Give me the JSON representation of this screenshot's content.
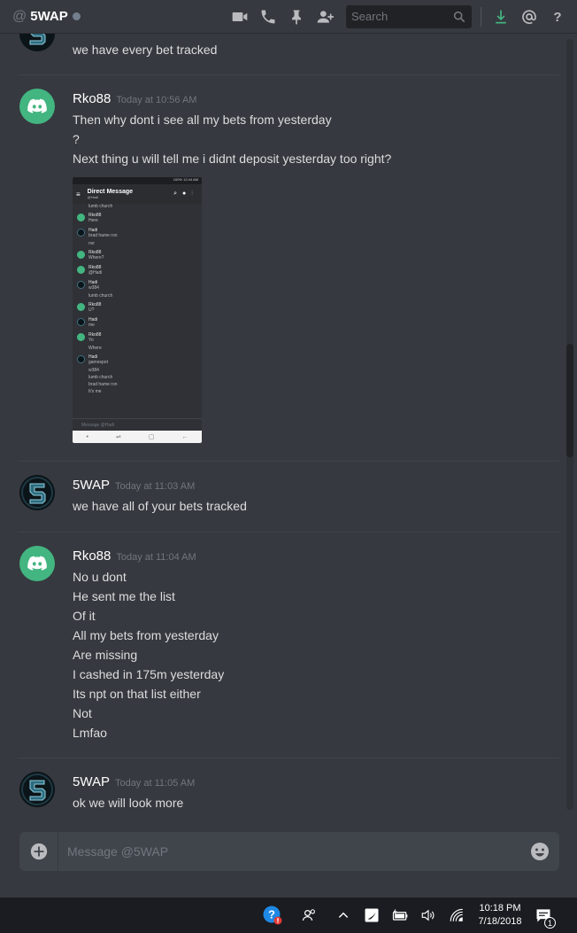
{
  "header": {
    "at_symbol": "@",
    "channel_name": "5WAP",
    "search_placeholder": "Search",
    "icons": [
      "video-call-icon",
      "voice-call-icon",
      "pin-icon",
      "add-friend-icon",
      "search-icon",
      "download-icon",
      "mention-icon",
      "help-icon"
    ]
  },
  "messages": [
    {
      "type": "continuation",
      "lines": [
        "we have every bet tracked"
      ]
    },
    {
      "author": "Rko88",
      "avatar": "discord",
      "timestamp": "Today at 10:56 AM",
      "lines": [
        "Then why dont i see all my bets from yesterday",
        "?",
        "Next thing u will tell me i didnt deposit yesterday too right?"
      ]
    },
    {
      "author": "5WAP",
      "avatar": "5wap",
      "timestamp": "Today at 11:03 AM",
      "lines": [
        "we have all of your bets tracked"
      ]
    },
    {
      "author": "Rko88",
      "avatar": "discord",
      "timestamp": "Today at 11:04 AM",
      "lines": [
        "No u dont",
        "He sent me the list",
        "Of it",
        "All my bets from yesterday",
        "Are missing",
        "I cashed in 175m yesterday",
        "Its npt on that list either",
        "Not",
        "Lmfao"
      ]
    },
    {
      "author": "5WAP",
      "avatar": "5wap",
      "timestamp": "Today at 11:05 AM",
      "lines": [
        "ok we will look more"
      ]
    }
  ],
  "embed": {
    "status_bar": "100% 12:44 AM",
    "title": "Direct Message",
    "subtitle": "@Hadi",
    "rows": [
      {
        "name": "",
        "text": "lumb church",
        "av": ""
      },
      {
        "name": "Rko88",
        "text": "Here",
        "av": "discord"
      },
      {
        "name": "Hadi",
        "text": "brad hame ron",
        "av": "dark"
      },
      {
        "name": "",
        "text": "nvr",
        "av": ""
      },
      {
        "name": "Rko88",
        "text": "Where?",
        "av": "discord"
      },
      {
        "name": "Rko88",
        "text": "@Hadi",
        "av": "discord"
      },
      {
        "name": "Hadi",
        "text": "w384",
        "av": "dark"
      },
      {
        "name": "",
        "text": "lumb church",
        "av": ""
      },
      {
        "name": "Rko88",
        "text": "U?",
        "av": "discord"
      },
      {
        "name": "Hadi",
        "text": "me",
        "av": "dark"
      },
      {
        "name": "Rko88",
        "text": "Yo",
        "av": "discord"
      },
      {
        "name": "",
        "text": "Where",
        "av": ""
      },
      {
        "name": "Hadi",
        "text": "gamespot",
        "av": "dark"
      },
      {
        "name": "",
        "text": "w384",
        "av": ""
      },
      {
        "name": "",
        "text": "lumb church",
        "av": ""
      },
      {
        "name": "",
        "text": "brad hame ron",
        "av": ""
      },
      {
        "name": "",
        "text": "It's me",
        "av": ""
      }
    ],
    "input_placeholder": "Message @Hadi"
  },
  "composer": {
    "placeholder": "Message @5WAP"
  },
  "taskbar": {
    "time": "10:18 PM",
    "date": "7/18/2018",
    "notification_count": "1",
    "icons": [
      "help-icon",
      "people-icon",
      "chevron-up-icon",
      "app-icon",
      "battery-icon",
      "volume-icon",
      "wifi-icon",
      "notification-icon"
    ]
  },
  "colors": {
    "background": "#36393f",
    "discord_green": "#43b581",
    "text": "#dcddde",
    "muted": "#72767d",
    "download_green": "#43b581"
  }
}
